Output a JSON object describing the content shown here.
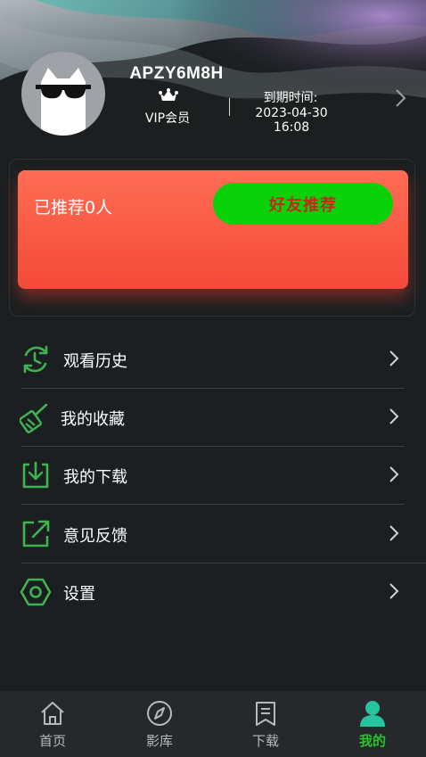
{
  "profile": {
    "username": "APZY6M8H",
    "membership": "VIP会员",
    "expire_label": "到期时间:",
    "expire_value": "2023-04-30 16:08"
  },
  "referral": {
    "count_text": "已推荐0人",
    "button_label": "好友推荐"
  },
  "menu": {
    "items": [
      {
        "label": "观看历史",
        "icon": "history-icon"
      },
      {
        "label": "我的收藏",
        "icon": "favorites-icon"
      },
      {
        "label": "我的下载",
        "icon": "download-icon"
      },
      {
        "label": "意见反馈",
        "icon": "feedback-icon"
      },
      {
        "label": "设置",
        "icon": "settings-icon"
      }
    ]
  },
  "tabbar": {
    "tabs": [
      {
        "label": "首页",
        "icon": "home-icon"
      },
      {
        "label": "影库",
        "icon": "compass-icon"
      },
      {
        "label": "下载",
        "icon": "bookmark-icon"
      },
      {
        "label": "我的",
        "icon": "user-icon"
      }
    ],
    "active_index": 3
  },
  "colors": {
    "background": "#1b1f21",
    "accent_green": "#27c52b",
    "card_red": "#f85742",
    "button_green": "#0ad20a",
    "button_text": "#c22a1b"
  }
}
